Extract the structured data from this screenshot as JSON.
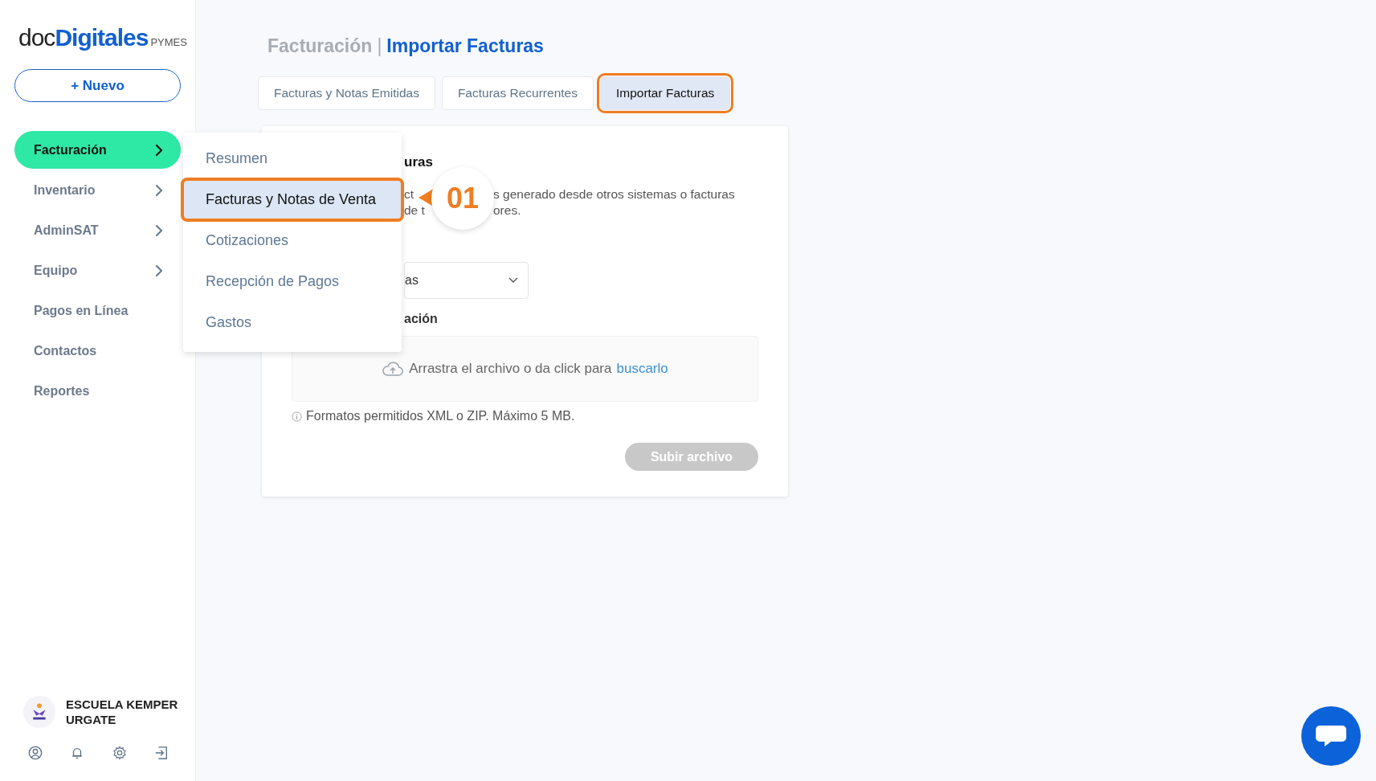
{
  "sidebar": {
    "logo": {
      "prefix": "doc",
      "brand": "Digitales",
      "suffix": "PYMES"
    },
    "new_button": "+ Nuevo",
    "items": [
      {
        "label": "Facturación",
        "selected": true,
        "has_submenu": true
      },
      {
        "label": "Inventario",
        "selected": false,
        "has_submenu": true
      },
      {
        "label": "AdminSAT",
        "selected": false,
        "has_submenu": true
      },
      {
        "label": "Equipo",
        "selected": false,
        "has_submenu": true
      },
      {
        "label": "Pagos en Línea",
        "selected": false,
        "has_submenu": false
      },
      {
        "label": "Contactos",
        "selected": false,
        "has_submenu": false
      },
      {
        "label": "Reportes",
        "selected": false,
        "has_submenu": false
      }
    ],
    "account": {
      "name": "ESCUELA KEMPER URGATE"
    }
  },
  "submenu": {
    "items": [
      {
        "label": "Resumen",
        "selected": false,
        "highlighted": false
      },
      {
        "label": "Facturas y Notas de Venta",
        "selected": true,
        "highlighted": true
      },
      {
        "label": "Cotizaciones",
        "selected": false,
        "highlighted": false
      },
      {
        "label": "Recepción de Pagos",
        "selected": false,
        "highlighted": false
      },
      {
        "label": "Gastos",
        "selected": false,
        "highlighted": false
      }
    ]
  },
  "callout": {
    "label": "01"
  },
  "header": {
    "section": "Facturación",
    "separator": "|",
    "page": "Importar Facturas"
  },
  "tabs": [
    {
      "label": "Facturas y Notas Emitidas",
      "selected": false,
      "highlighted": false
    },
    {
      "label": "Facturas Recurrentes",
      "selected": false,
      "highlighted": false
    },
    {
      "label": "Importar Facturas",
      "selected": true,
      "highlighted": true
    }
  ],
  "card": {
    "title": "uras",
    "description": [
      {
        "left": "ct",
        "right": "s generado desde otros sistemas o facturas"
      },
      {
        "left": "de t",
        "right": "ores."
      }
    ],
    "select": {
      "value": "as"
    },
    "upload_label": "ación",
    "dropzone": {
      "text": "Arrastra el archivo o da click para",
      "link": "buscarlo"
    },
    "hint": "Formatos permitidos XML o ZIP. Máximo 5 MB.",
    "submit": {
      "label": "Subir archivo",
      "disabled": true
    }
  }
}
